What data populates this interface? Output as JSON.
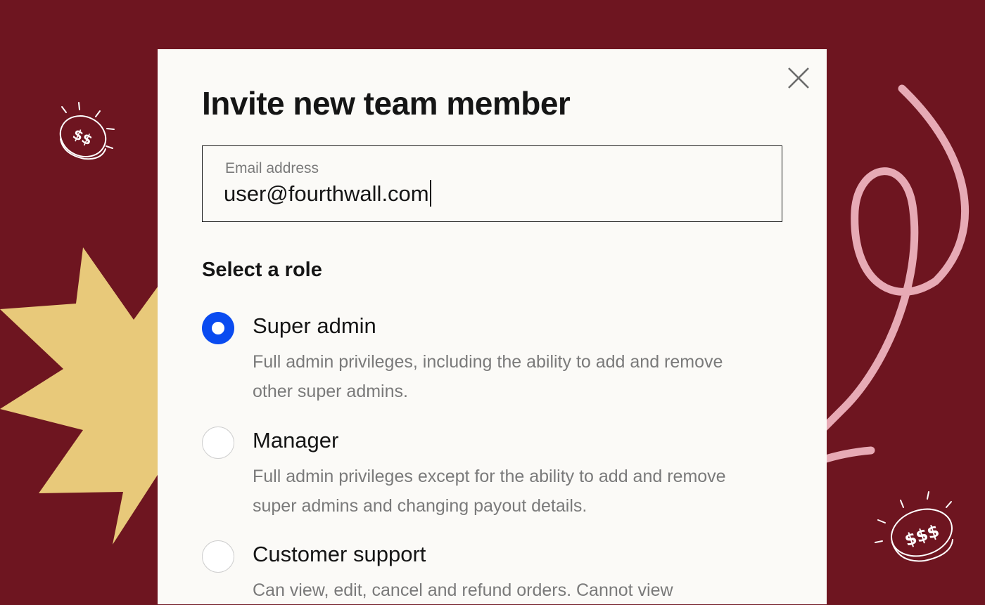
{
  "modal": {
    "title": "Invite new team member",
    "email_label": "Email address",
    "email_value": "user@fourthwall.com",
    "section_title": "Select a role",
    "roles": [
      {
        "name": "Super admin",
        "description": "Full admin privileges, including the ability to add and remove other super admins.",
        "selected": true
      },
      {
        "name": "Manager",
        "description": "Full admin privileges except for the ability to add and remove super admins and changing payout details.",
        "selected": false
      },
      {
        "name": "Customer support",
        "description": "Can view, edit, cancel and refund orders. Cannot view",
        "selected": false
      }
    ]
  },
  "icons": {
    "close": "close-icon",
    "coin_left": "dollar-coin-icon",
    "coin_right": "dollar-coin-icon",
    "starburst": "starburst-shape",
    "squiggle_arrow": "curly-arrow-shape"
  },
  "colors": {
    "background": "#6e1520",
    "modal": "#fbfaf7",
    "accent": "#0a4bf0",
    "starburst": "#e8c97a",
    "squiggle": "#e7aab5"
  }
}
